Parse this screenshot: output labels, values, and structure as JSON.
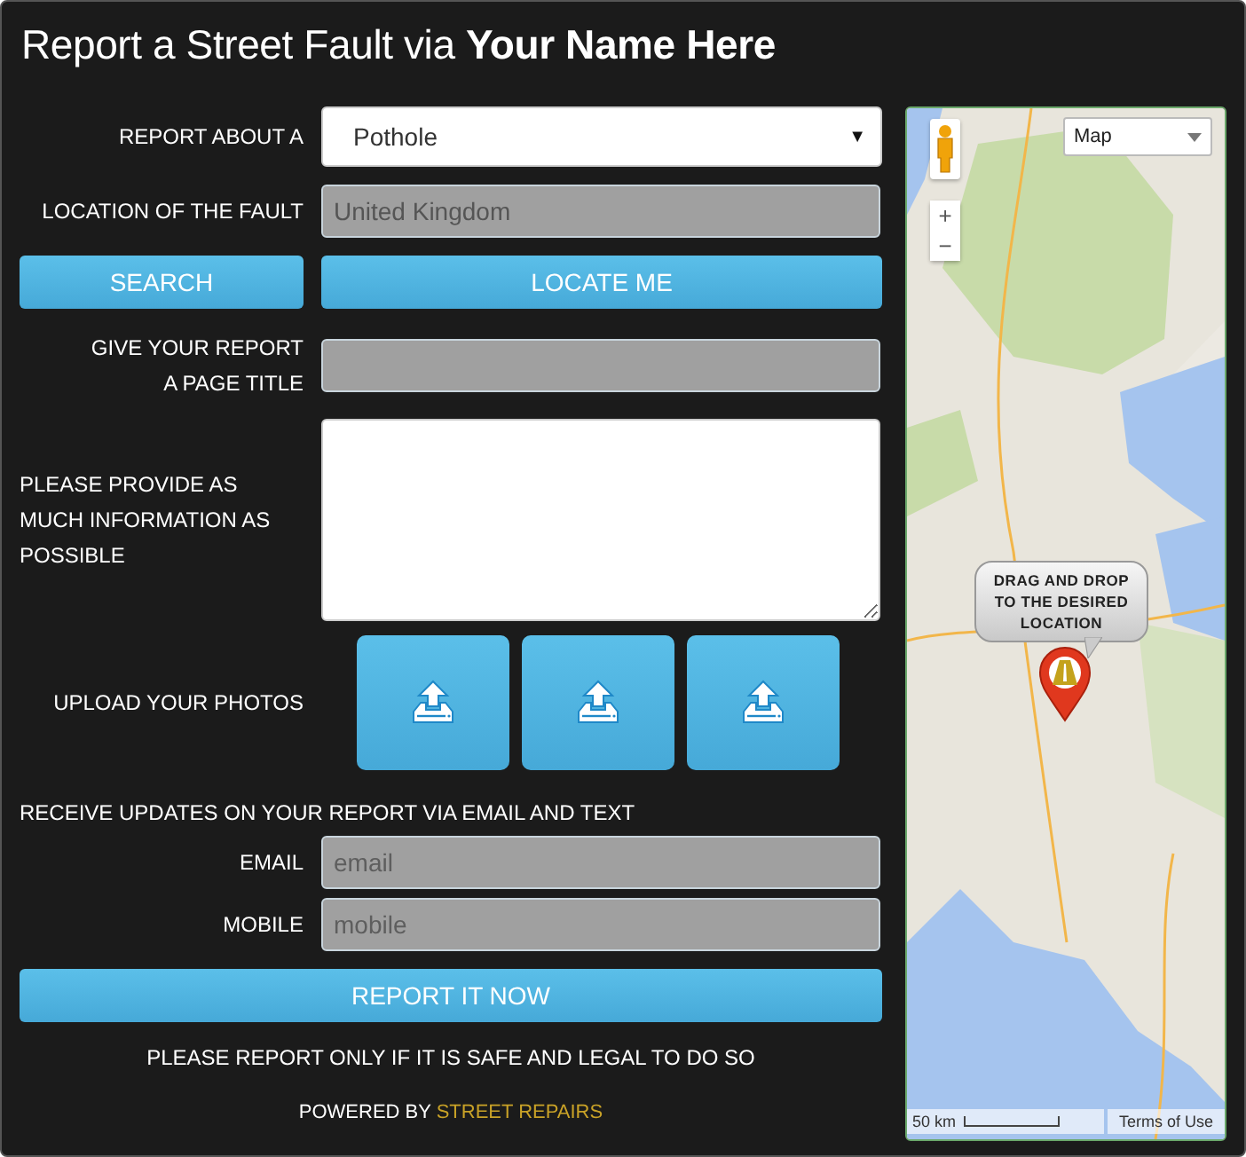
{
  "title": "Report a Street Fault via **Your Name Here**",
  "report_about": {
    "label": "REPORT ABOUT A",
    "value": "Pothole",
    "caret": "▼"
  },
  "location": {
    "label": "LOCATION OF THE FAULT",
    "value": "United Kingdom"
  },
  "buttons": {
    "search": "SEARCH",
    "locate": "LOCATE ME"
  },
  "page_title": {
    "label": "GIVE YOUR REPORT A PAGE TITLE"
  },
  "information": {
    "label": "PLEASE PROVIDE AS MUCH INFORMATION AS POSSIBLE"
  },
  "upload": {
    "label": "UPLOAD YOUR PHOTOS"
  },
  "updates": {
    "heading": "RECEIVE UPDATES ON YOUR REPORT VIA EMAIL AND TEXT",
    "fields": [
      {
        "label": "EMAIL",
        "placeholder": "email"
      },
      {
        "label": "MOBILE",
        "placeholder": "mobile"
      }
    ]
  },
  "submit": "REPORT IT NOW",
  "note": "PLEASE REPORT ONLY IF IT IS SAFE AND LEGAL TO DO SO",
  "powered": {
    "prefix": "POWERED BY",
    "brand": "STREET REPAIRS"
  },
  "map": {
    "type_select": "Map",
    "zoom_in": "+",
    "zoom_out": "−",
    "callout": "DRAG AND DROP TO THE DESIRED LOCATION",
    "scale": "50 km",
    "terms": "Terms of Use"
  }
}
